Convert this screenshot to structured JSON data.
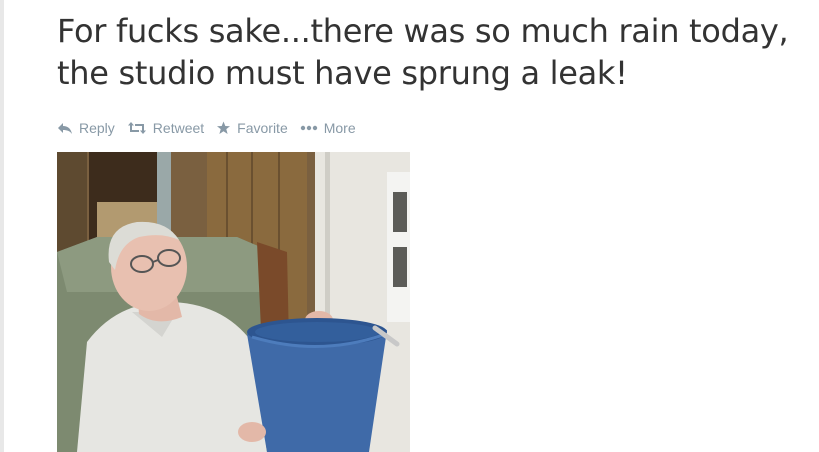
{
  "tweet": {
    "text": "For fucks sake...there was so much rain today, the studio must have sprung a leak!"
  },
  "actions": {
    "reply_label": "Reply",
    "retweet_label": "Retweet",
    "favorite_label": "Favorite",
    "more_label": "More"
  },
  "icons": {
    "reply": "reply-icon",
    "retweet": "retweet-icon",
    "favorite": "star-icon",
    "more": "more-dots-icon"
  },
  "colors": {
    "text": "#333333",
    "action": "#8899a6"
  }
}
